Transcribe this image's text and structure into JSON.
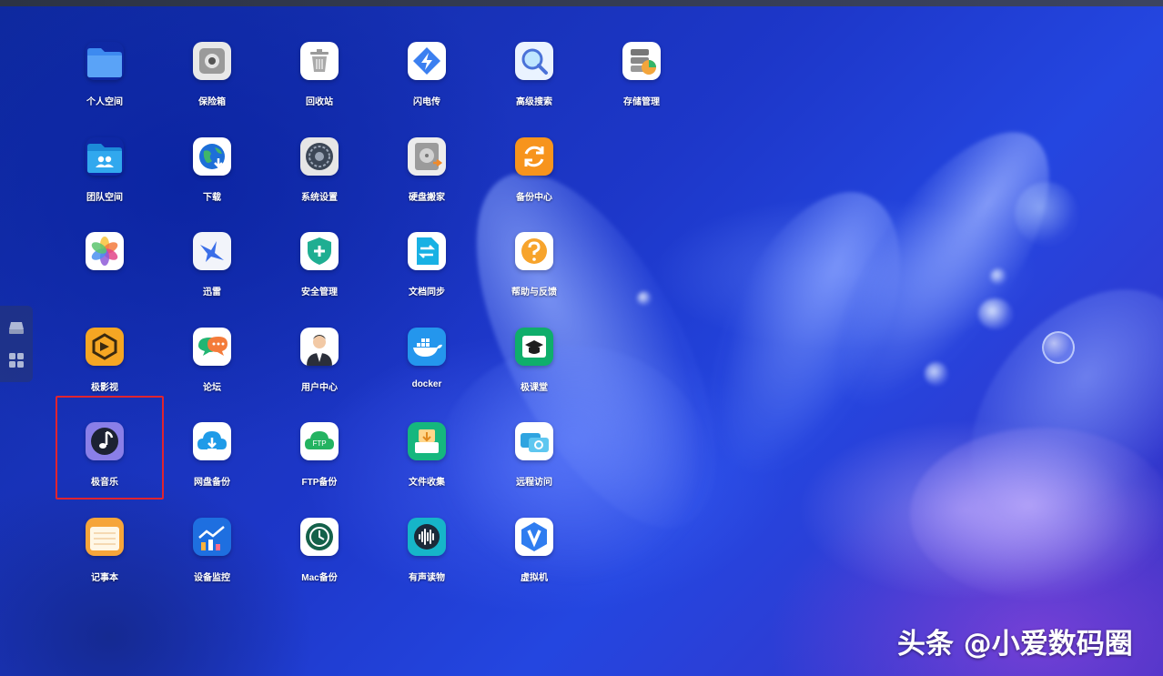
{
  "desktop": {
    "apps": [
      {
        "label": "个人空间",
        "icon": "folder-icon"
      },
      {
        "label": "保险箱",
        "icon": "safe-icon"
      },
      {
        "label": "回收站",
        "icon": "trash-icon"
      },
      {
        "label": "闪电传",
        "icon": "lightning-transfer-icon"
      },
      {
        "label": "高级搜索",
        "icon": "advanced-search-icon"
      },
      {
        "label": "存储管理",
        "icon": "storage-management-icon"
      },
      {
        "label": "团队空间",
        "icon": "team-folder-icon"
      },
      {
        "label": "下载",
        "icon": "download-globe-icon"
      },
      {
        "label": "系统设置",
        "icon": "settings-icon"
      },
      {
        "label": "硬盘搬家",
        "icon": "disk-migration-icon"
      },
      {
        "label": "备份中心",
        "icon": "backup-center-icon"
      },
      {
        "label": "",
        "icon": "photos-icon"
      },
      {
        "label": "迅雷",
        "icon": "thunder-bird-icon"
      },
      {
        "label": "安全管理",
        "icon": "security-shield-icon"
      },
      {
        "label": "文档同步",
        "icon": "document-sync-icon"
      },
      {
        "label": "帮助与反馈",
        "icon": "help-icon"
      },
      {
        "label": "极影视",
        "icon": "video-icon"
      },
      {
        "label": "论坛",
        "icon": "forum-chat-icon"
      },
      {
        "label": "用户中心",
        "icon": "user-avatar-icon"
      },
      {
        "label": "docker",
        "icon": "docker-whale-icon"
      },
      {
        "label": "极课堂",
        "icon": "classroom-cap-icon"
      },
      {
        "label": "极音乐",
        "icon": "music-note-icon"
      },
      {
        "label": "网盘备份",
        "icon": "cloud-backup-icon"
      },
      {
        "label": "FTP备份",
        "icon": "ftp-cloud-icon"
      },
      {
        "label": "文件收集",
        "icon": "file-collect-icon"
      },
      {
        "label": "远程访问",
        "icon": "remote-access-icon"
      },
      {
        "label": "记事本",
        "icon": "notepad-icon"
      },
      {
        "label": "设备监控",
        "icon": "device-monitor-chart-icon"
      },
      {
        "label": "Mac备份",
        "icon": "mac-backup-clock-icon"
      },
      {
        "label": "有声读物",
        "icon": "audiobook-waveform-icon"
      },
      {
        "label": "虚拟机",
        "icon": "virtual-machine-v-icon"
      }
    ]
  },
  "dock": {
    "items": [
      {
        "icon": "drive-icon"
      },
      {
        "icon": "apps-grid-icon"
      }
    ]
  },
  "watermark": "头条 @小爱数码圈",
  "colors": {
    "highlight": "#e0242f",
    "label": "#ffffff"
  }
}
